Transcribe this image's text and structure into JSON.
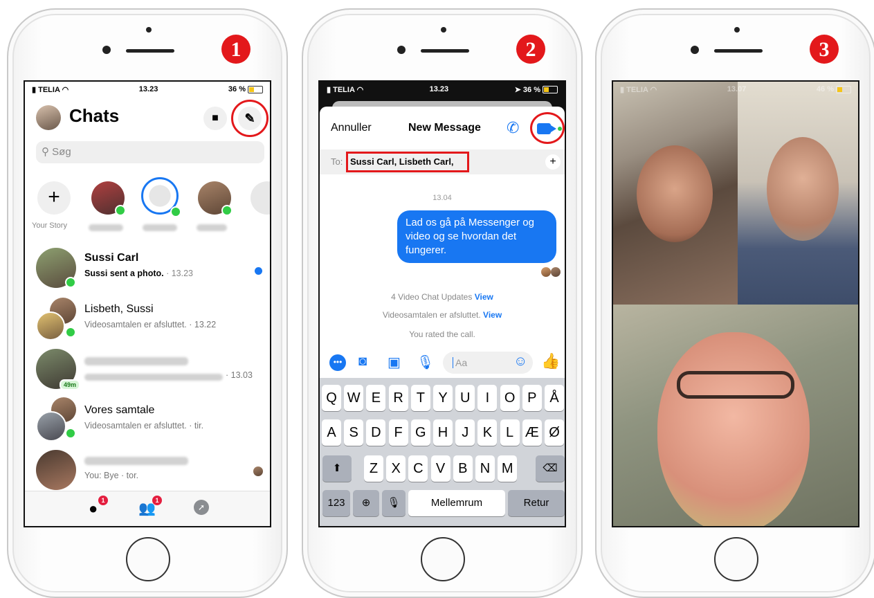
{
  "steps": [
    "1",
    "2",
    "3"
  ],
  "phone1": {
    "status": {
      "carrier": "TELIA",
      "time": "13.23",
      "battery": "36 %"
    },
    "title": "Chats",
    "search_placeholder": "Søg",
    "your_story": "Your Story",
    "chats": [
      {
        "name": "Sussi Carl",
        "preview": "Sussi sent a photo.",
        "time": " · 13.23",
        "unread": true
      },
      {
        "name": "Lisbeth, Sussi",
        "preview": "Videosamtalen er afsluttet. · 13.22"
      },
      {
        "name": "",
        "preview": "",
        "time": "· 13.03",
        "badge": "49m"
      },
      {
        "name": "Vores samtale",
        "preview": "Videosamtalen er afsluttet. · tir."
      },
      {
        "name": "",
        "preview": "You: Bye · tor."
      }
    ],
    "tab_badges": [
      "1",
      "1"
    ]
  },
  "phone2": {
    "status": {
      "carrier": "TELIA",
      "time": "13.23",
      "battery": "36 %"
    },
    "cancel": "Annuller",
    "title": "New Message",
    "to_label": "To:",
    "recipients": "Sussi Carl,  Lisbeth Carl,",
    "timestamp": "13.04",
    "bubble": "Lad os gå på Messenger og video og se hvordan det fungerer.",
    "updates": [
      {
        "text": "4 Video Chat Updates",
        "link": "View"
      },
      {
        "text": "Videosamtalen er afsluttet.",
        "link": "View"
      },
      {
        "text": "You rated the call.",
        "link": ""
      }
    ],
    "input_placeholder": "Aa",
    "keyboard": {
      "row1": [
        "Q",
        "W",
        "E",
        "R",
        "T",
        "Y",
        "U",
        "I",
        "O",
        "P",
        "Å"
      ],
      "row2": [
        "A",
        "S",
        "D",
        "F",
        "G",
        "H",
        "J",
        "K",
        "L",
        "Æ",
        "Ø"
      ],
      "row3": [
        "Z",
        "X",
        "C",
        "V",
        "B",
        "N",
        "M"
      ],
      "num": "123",
      "space": "Mellemrum",
      "return": "Retur"
    }
  },
  "phone3": {
    "status": {
      "carrier": "TELIA",
      "time": "13.07",
      "battery": "46 %"
    }
  }
}
